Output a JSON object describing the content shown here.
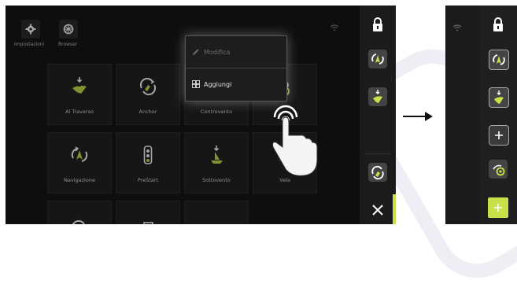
{
  "colors": {
    "accent": "#c8e04a",
    "panel": "#161616",
    "tile": "#222222"
  },
  "toolbar": {
    "settings_label": "Impostazioni",
    "browser_label": "Browser"
  },
  "tiles": [
    {
      "label": "Al Traverso",
      "icon": "boat-down-icon"
    },
    {
      "label": "Anchor",
      "icon": "anchor-swirl-icon"
    },
    {
      "label": "Controvento",
      "icon": "boat-up-icon"
    },
    {
      "label": "",
      "icon": "sail-lock-icon"
    },
    {
      "label": "Navigazione",
      "icon": "navigation-rotate-icon"
    },
    {
      "label": "PreStart",
      "icon": "traffic-light-icon"
    },
    {
      "label": "Sottovento",
      "icon": "boat-downwind-icon"
    },
    {
      "label": "Vela",
      "icon": "sail-icon"
    }
  ],
  "context_menu": {
    "items": [
      {
        "label": "Modifica",
        "icon": "pencil-icon",
        "enabled": false
      },
      {
        "label": "Aggiungi",
        "icon": "grid-add-icon",
        "enabled": true
      }
    ]
  }
}
